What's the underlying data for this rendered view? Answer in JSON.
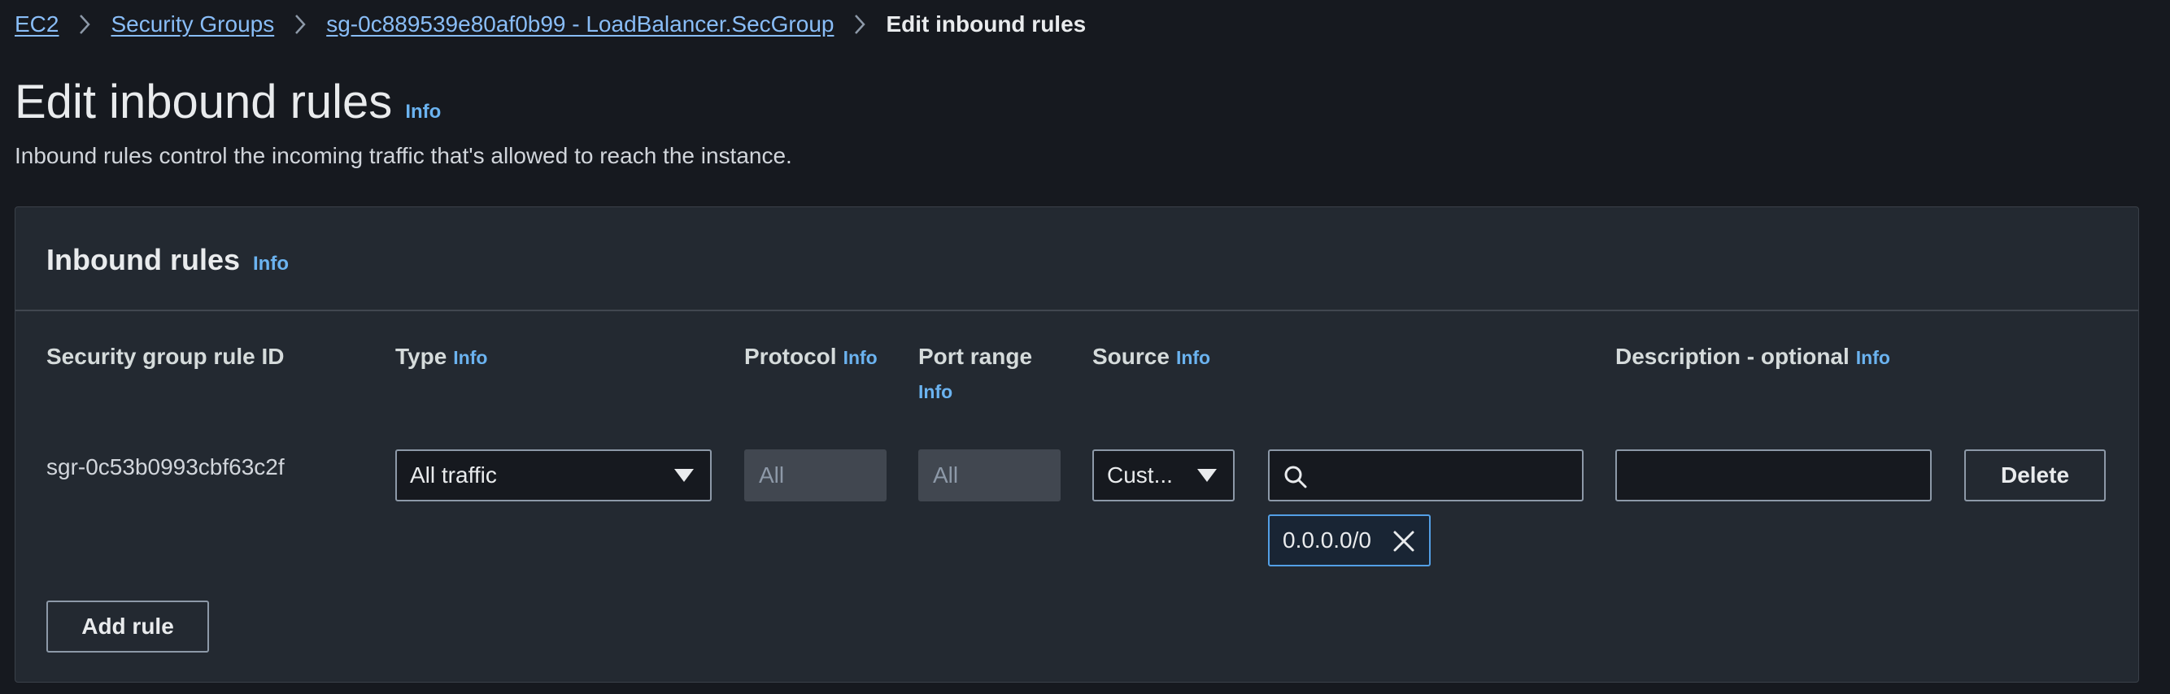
{
  "breadcrumb": {
    "items": [
      "EC2",
      "Security Groups",
      "sg-0c889539e80af0b99 - LoadBalancer.SecGroup"
    ],
    "current": "Edit inbound rules"
  },
  "page": {
    "title": "Edit inbound rules",
    "info": "Info",
    "description": "Inbound rules control the incoming traffic that's allowed to reach the instance."
  },
  "panel": {
    "title": "Inbound rules",
    "info": "Info"
  },
  "columns": {
    "rule_id": "Security group rule ID",
    "type": "Type",
    "protocol": "Protocol",
    "port_range": "Port range",
    "source": "Source",
    "description": "Description - optional",
    "info": "Info"
  },
  "rule": {
    "id": "sgr-0c53b0993cbf63c2f",
    "type": "All traffic",
    "protocol": "All",
    "port_range": "All",
    "source_type": "Cust...",
    "source_search_value": "",
    "source_token": "0.0.0.0/0",
    "description_value": "",
    "delete_label": "Delete"
  },
  "actions": {
    "add_rule": "Add rule"
  },
  "colors": {
    "background": "#16191f",
    "panel": "#232931",
    "link": "#89bdf7",
    "info": "#6bb3f0",
    "token_border": "#539fe5"
  }
}
